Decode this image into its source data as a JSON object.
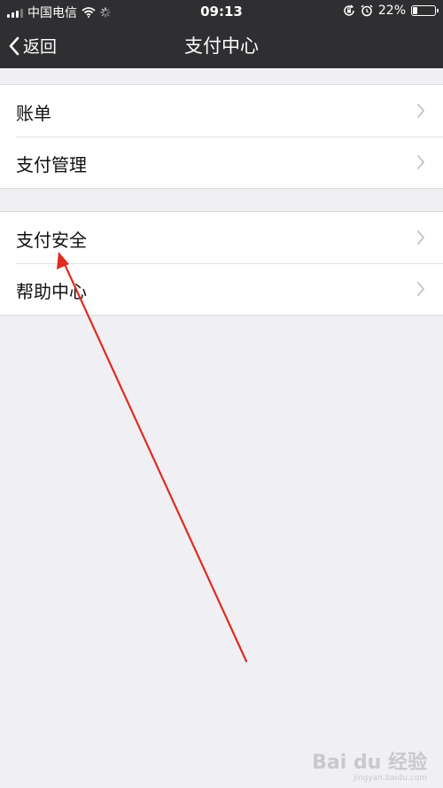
{
  "status_bar": {
    "carrier": "中国电信",
    "time": "09:13",
    "battery": "22%"
  },
  "nav": {
    "back_label": "返回",
    "title": "支付中心"
  },
  "groups": [
    {
      "items": [
        {
          "label": "账单"
        },
        {
          "label": "支付管理"
        }
      ]
    },
    {
      "items": [
        {
          "label": "支付安全"
        },
        {
          "label": "帮助中心"
        }
      ]
    }
  ],
  "annotation": {
    "color": "#e02b20"
  },
  "watermark": {
    "brand": "Bai du 经验",
    "url": "jingyan.baidu.com"
  },
  "colors": {
    "nav_bg": "#2f2f32",
    "page_bg": "#efeff4"
  }
}
